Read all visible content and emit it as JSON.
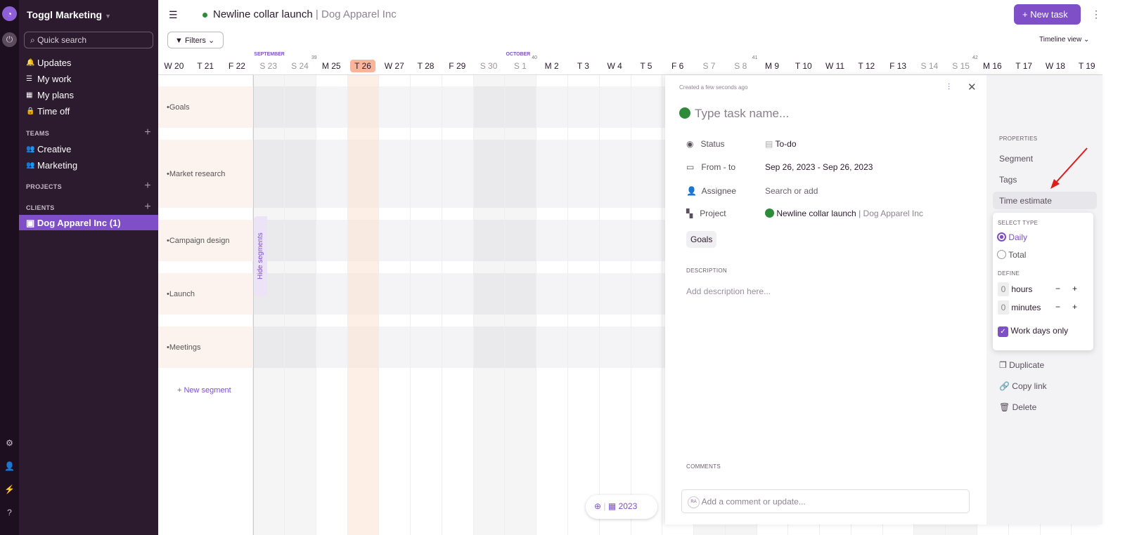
{
  "sidebar": {
    "workspace": "Toggl Marketing",
    "search_placeholder": "Quick search",
    "nav": [
      {
        "label": "Updates",
        "icon": "bell-icon"
      },
      {
        "label": "My work",
        "icon": "list-icon"
      },
      {
        "label": "My plans",
        "icon": "plans-icon"
      },
      {
        "label": "Time off",
        "icon": "lock-icon"
      }
    ],
    "teams_label": "TEAMS",
    "teams": [
      "Creative",
      "Marketing"
    ],
    "projects_label": "PROJECTS",
    "clients_label": "CLIENTS",
    "client": "Dog Apparel Inc (1)"
  },
  "header": {
    "project": "Newline collar launch",
    "client": "Dog Apparel Inc",
    "filters": "Filters",
    "new_task": "New task",
    "view": "Timeline view",
    "accent": "#7e4fc7"
  },
  "timeline": {
    "days": [
      "W 20",
      "T 21",
      "F 22",
      "S 23",
      "S 24",
      "M 25",
      "T 26",
      "W 27",
      "T 28",
      "F 29",
      "S 30",
      "S 1",
      "M 2",
      "T 3",
      "W 4",
      "T 5",
      "F 6",
      "S 7",
      "S 8",
      "M 9",
      "T 10",
      "W 11",
      "T 12",
      "F 13",
      "S 14",
      "S 15",
      "M 16",
      "T 17",
      "W 18",
      "T 19"
    ],
    "weekend_indices": [
      3,
      4,
      10,
      11,
      17,
      18,
      24,
      25
    ],
    "today_index": 6,
    "months": [
      {
        "label": "SEPTEMBER",
        "index": 3
      },
      {
        "label": "OCTOBER",
        "index": 11
      }
    ],
    "weeks": [
      {
        "label": "39",
        "index": 5
      },
      {
        "label": "40",
        "index": 12
      },
      {
        "label": "41",
        "index": 19
      },
      {
        "label": "42",
        "index": 26
      }
    ],
    "segments": [
      "Goals",
      "Market research",
      "Campaign design",
      "Launch",
      "Meetings"
    ],
    "new_segment": "New segment",
    "hide_segments": "Hide segments",
    "year": "2023"
  },
  "task": {
    "created": "Created a few seconds ago",
    "name_placeholder": "Type task name...",
    "status_label": "Status",
    "status": "To-do",
    "dates_label": "From - to",
    "dates": "Sep 26, 2023 - Sep 26, 2023",
    "assignee_label": "Assignee",
    "assignee_placeholder": "Search or add",
    "project_label": "Project",
    "project": "Newline collar launch",
    "client": "Dog Apparel Inc",
    "segment_tag": "Goals",
    "description_label": "DESCRIPTION",
    "description_placeholder": "Add description here...",
    "comments_label": "COMMENTS",
    "comment_placeholder": "Add a comment or update...",
    "avatar": "RA"
  },
  "properties": {
    "title": "PROPERTIES",
    "items": [
      "Segment",
      "Tags",
      "Time estimate"
    ],
    "estimate": {
      "select_type": "SELECT TYPE",
      "daily": "Daily",
      "total": "Total",
      "selected": "Daily",
      "define": "DEFINE",
      "hours": "0",
      "hours_label": "hours",
      "minutes": "0",
      "minutes_label": "minutes",
      "work_days_only": "Work days only",
      "work_days_checked": true
    },
    "actions": [
      "Duplicate",
      "Copy link",
      "Delete"
    ]
  }
}
